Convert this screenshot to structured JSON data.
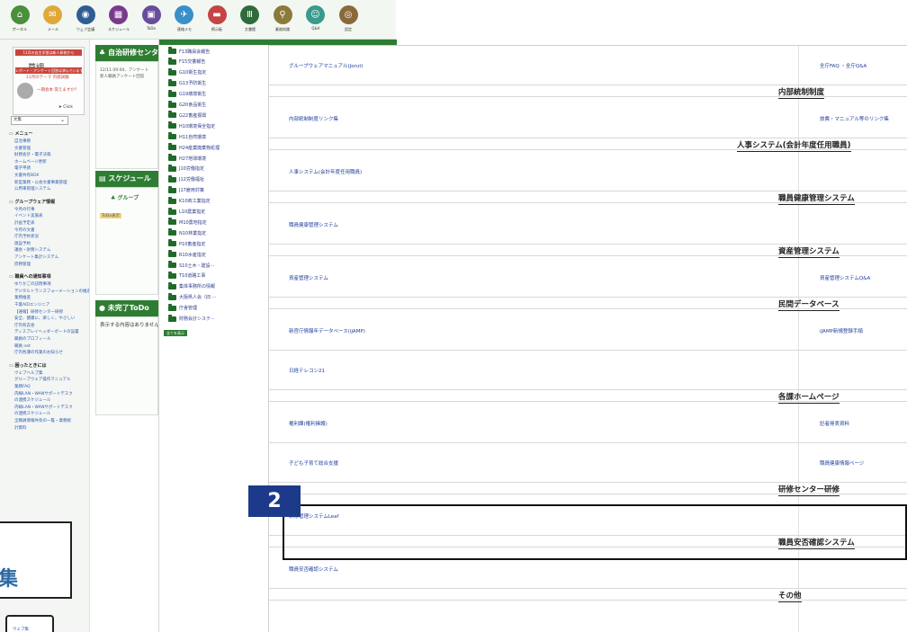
{
  "toolbar": {
    "items": [
      {
        "label": "ポータル",
        "icon": "portal-icon",
        "color": "#4a8f3c"
      },
      {
        "label": "メール",
        "icon": "mail-icon",
        "color": "#e0a83a"
      },
      {
        "label": "ウェブ会議",
        "icon": "web-meeting-icon",
        "color": "#2f5d92"
      },
      {
        "label": "スケジュール",
        "icon": "schedule-icon",
        "color": "#7a3a8c"
      },
      {
        "label": "ToDo",
        "icon": "todo-icon",
        "color": "#6a4c9c"
      },
      {
        "label": "連絡メモ",
        "icon": "memo-icon",
        "color": "#3a8fc8"
      },
      {
        "label": "掲示板",
        "icon": "board-icon",
        "color": "#c54444"
      },
      {
        "label": "文書館",
        "icon": "library-icon",
        "color": "#2f6b3a"
      },
      {
        "label": "業務知識",
        "icon": "knowledge-icon",
        "color": "#8c7a3a"
      },
      {
        "label": "Q&A",
        "icon": "qa-icon",
        "color": "#3a9a8c"
      },
      {
        "label": "設定",
        "icon": "settings-icon",
        "color": "#8a6a3a"
      }
    ]
  },
  "sidebar": {
    "banner": {
      "line1": "11月の自主学習は新人研修から",
      "title": "草調",
      "line2": "レポート・アンケート回答は済んでいますか",
      "line3": "11月のテーマ 内部試験",
      "question": "一期会本 覚えますか?",
      "click": "Click"
    },
    "select_value": "文集",
    "menu_title": "メニュー",
    "menu_links": [
      "自治事務",
      "文書管理",
      "財務会計・電子決裁",
      "ホームページ更新",
      "電子申請",
      "文書共有BOX",
      "新型業務・公会文書事業管理",
      "公用車管理システム"
    ],
    "groupware_title": "グループウェア情報",
    "groupware_links": [
      "今月の行事",
      "イベント実施表",
      "計画予定表",
      "今月の文書",
      "庁内予約状況",
      "施設予約",
      "議会・財務システム",
      "アンケート集計システム",
      "庶務管理"
    ],
    "notice_title": "職員への通知事項",
    "notice_links": [
      "ゆりかごの訪問事項",
      "デジタルトランスフォーメーションの推進",
      "業務推進",
      "千葉AIDエンジニア",
      "【通報】研修センター研修",
      "安全、健康に、楽しく、やさしい",
      "庁内有志会",
      "ディスプレイヘッダーボードの設置",
      "職員のプロフィール",
      "職員 net",
      "庁内各課の作業のお知らせ"
    ],
    "trouble_title": "困ったときには",
    "trouble_links": [
      "ウェブヘルプ集",
      "グループウェア操作マニュアル",
      "業務FAQ",
      "内線LAN・WANサポートデスク",
      "の連携スケジュール",
      "内線LAN・WANサポートデスク",
      "の連携スケジュール",
      "全職員情報共有の一覧・業務統",
      "計資料"
    ],
    "callout1_text": "集",
    "callout2_text": "ウェブ集"
  },
  "middle": {
    "head1": "自治研修センター",
    "panel1_line1": "12/11 09:00、アンケート",
    "panel1_line2": "新人職員アンケート回答",
    "head2": "スケジュール",
    "group_label": "グループ",
    "todo_tag": "ToDo表示",
    "head3": "未完了ToDo",
    "todo_empty": "表示する内容はありません"
  },
  "tree": {
    "items": [
      "F13職員会報告",
      "F15交響報告",
      "G10衛生指定",
      "G13予防衛生",
      "G19環境衛生",
      "G20食品衛生",
      "G22畜産振興",
      "H10環境保全指定",
      "H11自然環境",
      "H24産業廃棄物処理",
      "H27地球環境",
      "J10労働指定",
      "J12労働福祉",
      "J17雇用対策",
      "K10商工業指定",
      "L10農業指定",
      "M10農地指定",
      "N10林業指定",
      "P10畜産指定",
      "R10水産指定",
      "S10土木・建設···",
      "T10道路工事",
      "集体事務所の情報",
      "大阪県人会（旧 ···",
      "庁舎管理",
      "財務会計システ···"
    ],
    "more": "全てを表示"
  },
  "main": {
    "rows": [
      {
        "left": "グループウェアマニュアル(Jorut)",
        "right": "全庁FAQ ・全庁Q&A"
      },
      {
        "category": "内部統制制度"
      },
      {
        "left": "内部統制制度リンク集",
        "right": "旅費・マニュアル等のリンク集"
      },
      {
        "category": "人事システム(会計年度任用職員)"
      },
      {
        "left": "人事システム(会計年度任用職員)",
        "right": ""
      },
      {
        "category": "職員健康管理システム"
      },
      {
        "left": "職員健康管理システム",
        "right": ""
      },
      {
        "category": "資産管理システム"
      },
      {
        "left": "資産管理システム",
        "right": "資産管理システムQ&A"
      },
      {
        "category": "民間データベース"
      },
      {
        "left": "新官庁情報年データベース(iJAMP)",
        "right": "iJAMP新規登録手順"
      },
      {
        "left": "日経テレコン21",
        "right": ""
      },
      {
        "category": "各課ホームページ"
      },
      {
        "left": "権利課(権利擁護)",
        "right": "記者発表資料"
      },
      {
        "left": "子ども子育て総合支援",
        "right": "職員健康情報ページ"
      },
      {
        "category": "研修センター研修"
      },
      {
        "left": "研修管理システムLeaf",
        "right": ""
      },
      {
        "category": "職員安否確認システム"
      },
      {
        "left": "職員安否確認システム",
        "right": ""
      },
      {
        "category": "その他"
      }
    ]
  },
  "callout_badge": "2"
}
